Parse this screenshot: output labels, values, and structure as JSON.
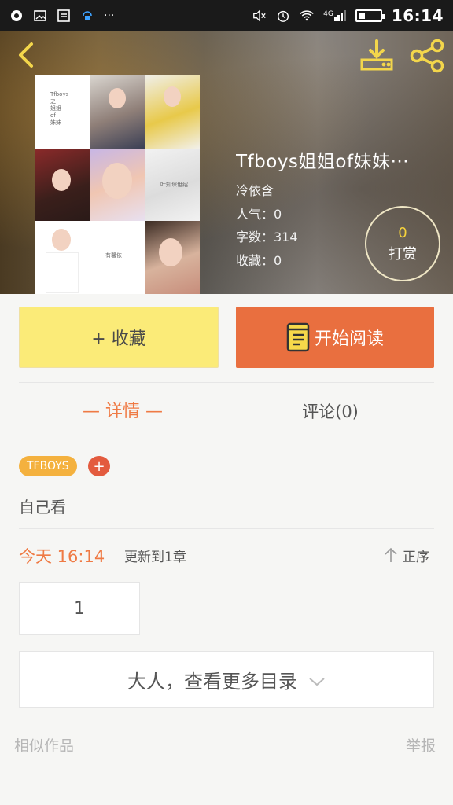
{
  "statusbar": {
    "time": "16:14",
    "network_label": "4G",
    "icons": [
      "app-icon",
      "image-icon",
      "message-icon",
      "vpn-icon",
      "more-icon",
      "mute-icon",
      "alarm-icon",
      "wifi-icon",
      "signal-icon",
      "battery-icon"
    ],
    "ellipsis": "···"
  },
  "header": {
    "back_icon": "chevron-left-icon",
    "download_icon": "download-icon",
    "share_icon": "share-icon"
  },
  "cover": {
    "title_text": "Tfboys\n之\n姐姐\nof\n妹妹",
    "cell_label_right": "叶知琛世绍",
    "cell_label_bottom": "有馨依"
  },
  "book": {
    "title": "Tfboys姐姐of妹妹···",
    "author": "冷依含",
    "popularity": "人气：0",
    "word_count": "字数：314",
    "favorites": "收藏：0"
  },
  "tip": {
    "count": "0",
    "label": "打赏"
  },
  "actions": {
    "collect_label": "+ 收藏",
    "read_label": "开始阅读"
  },
  "tabs": {
    "detail": "— 详情 —",
    "comment": "评论(0)"
  },
  "tags": {
    "tag": "TFBOYS",
    "add": "+"
  },
  "description": "自己看",
  "update": {
    "time": "今天 16:14",
    "text": "更新到1章",
    "sort_label": "正序"
  },
  "chapters": [
    {
      "number": "1"
    }
  ],
  "more": {
    "label": "大人，查看更多目录"
  },
  "footer": {
    "similar": "相似作品",
    "report": "举报"
  },
  "colors": {
    "accent_orange": "#e96f3f",
    "collect_yellow": "#fbeb78",
    "tag_yellow": "#f4b13e",
    "tag_red": "#e35b3e"
  }
}
